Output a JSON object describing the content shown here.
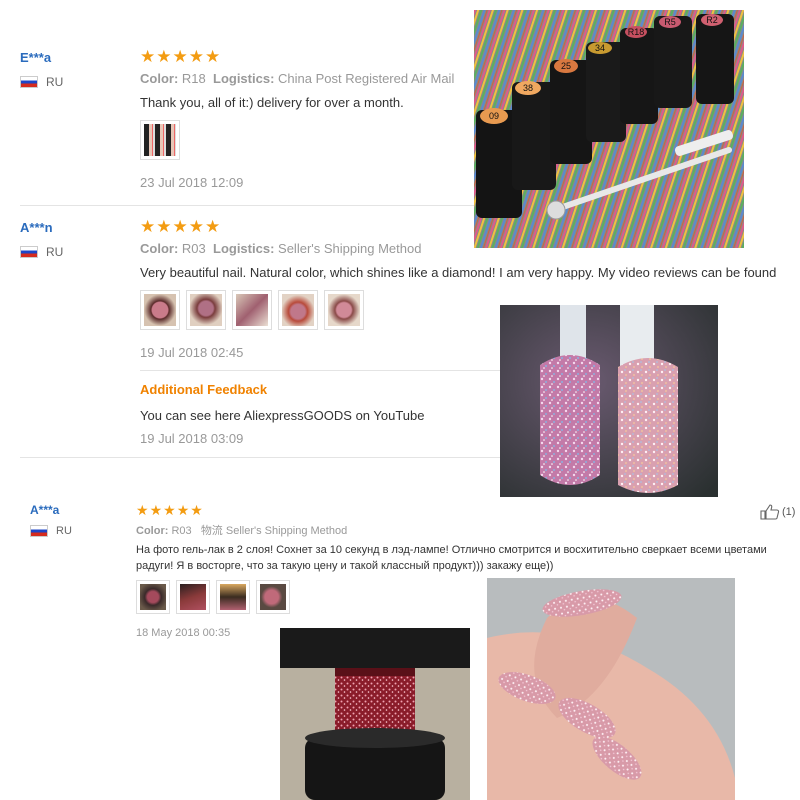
{
  "reviews": [
    {
      "user": "E***a",
      "country": "RU",
      "rating_stars": 5,
      "color_label": "Color:",
      "color_value": "R18",
      "logistics_label": "Logistics:",
      "logistics_value": "China Post Registered Air Mail",
      "text": "Thank you, all of it:) delivery for over a month.",
      "date": "23 Jul 2018 12:09"
    },
    {
      "user": "A***n",
      "country": "RU",
      "rating_stars": 5,
      "color_label": "Color:",
      "color_value": "R03",
      "logistics_label": "Logistics:",
      "logistics_value": "Seller's Shipping Method",
      "text": "Very beautiful nail. Natural color, which shines like a diamond! I am very happy. My video reviews can be found",
      "date": "19 Jul 2018 02:45",
      "additional_title": "Additional Feedback",
      "additional_text": "You can see here AliexpressGOODS on YouTube",
      "additional_date": "19 Jul 2018 03:09"
    },
    {
      "user": "A***a",
      "country": "RU",
      "rating_stars": 5,
      "color_label": "Color:",
      "color_value": "R03",
      "logistics_label": "物流",
      "logistics_value": "Seller's Shipping Method",
      "text": "На фото гель-лак в 2 слоя! Сохнет за 10 секунд в лэд-лампе! Отлично смотрится и восхитительно сверкает всеми цветами радуги! Я в восторге, что за такую цену и такой классный продукт))) закажу еще))",
      "date": "18 May 2018 00:35",
      "like_count": "(1)"
    }
  ],
  "icons": {
    "star": "★",
    "flag": "russia-flag-icon",
    "like": "thumbs-up-icon"
  },
  "colors": {
    "username": "#2a6bbd",
    "star": "#f39c12",
    "additional": "#f08200",
    "muted": "#999999"
  },
  "photos": {
    "bottle_labels": [
      "09",
      "38",
      "25",
      "34",
      "R18",
      "R5",
      "R2"
    ]
  }
}
